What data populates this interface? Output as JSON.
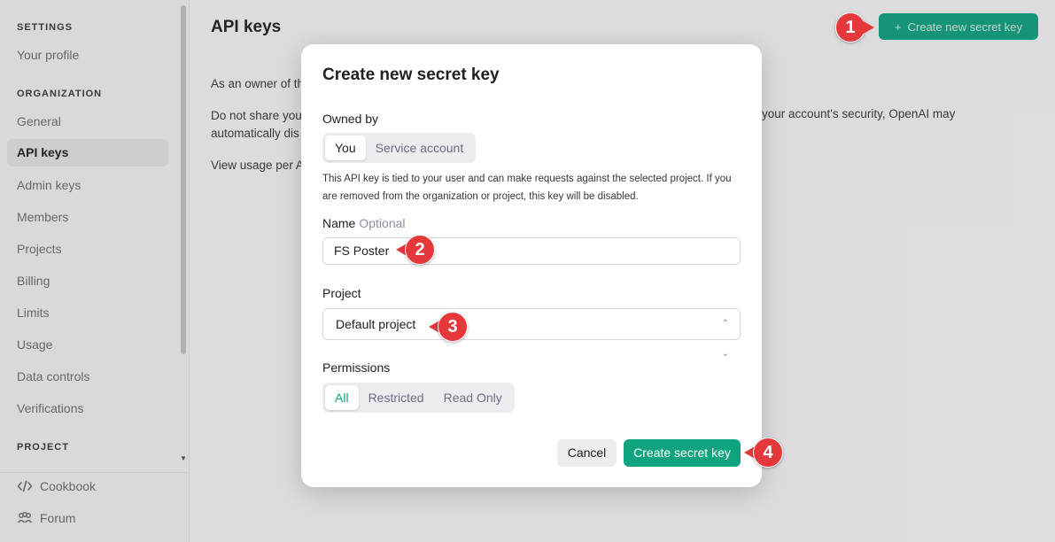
{
  "sidebar": {
    "section_settings": "SETTINGS",
    "your_profile": "Your profile",
    "section_org": "ORGANIZATION",
    "items": [
      "General",
      "API keys",
      "Admin keys",
      "Members",
      "Projects",
      "Billing",
      "Limits",
      "Usage",
      "Data controls",
      "Verifications"
    ],
    "section_project": "PROJECT",
    "cookbook": "Cookbook",
    "forum": "Forum"
  },
  "main": {
    "title": "API keys",
    "create_button": "Create new secret key",
    "text1": "As an owner of th",
    "text2a": "Do not share you",
    "text2b": "automatically dis",
    "text2_right": "your account's security, OpenAI may",
    "text3": "View usage per A"
  },
  "modal": {
    "title": "Create new secret key",
    "owned_by_label": "Owned by",
    "owned_you": "You",
    "owned_service": "Service account",
    "help_text": "This API key is tied to your user and can make requests against the selected project. If you are removed from the organization or project, this key will be disabled.",
    "name_label": "Name",
    "name_optional": "Optional",
    "name_value": "FS Poster",
    "project_label": "Project",
    "project_value": "Default project",
    "permissions_label": "Permissions",
    "perm_all": "All",
    "perm_restricted": "Restricted",
    "perm_readonly": "Read Only",
    "cancel": "Cancel",
    "create": "Create secret key"
  },
  "markers": [
    "1",
    "2",
    "3",
    "4"
  ],
  "colors": {
    "accent": "#10a37f",
    "marker": "#e5383b"
  }
}
